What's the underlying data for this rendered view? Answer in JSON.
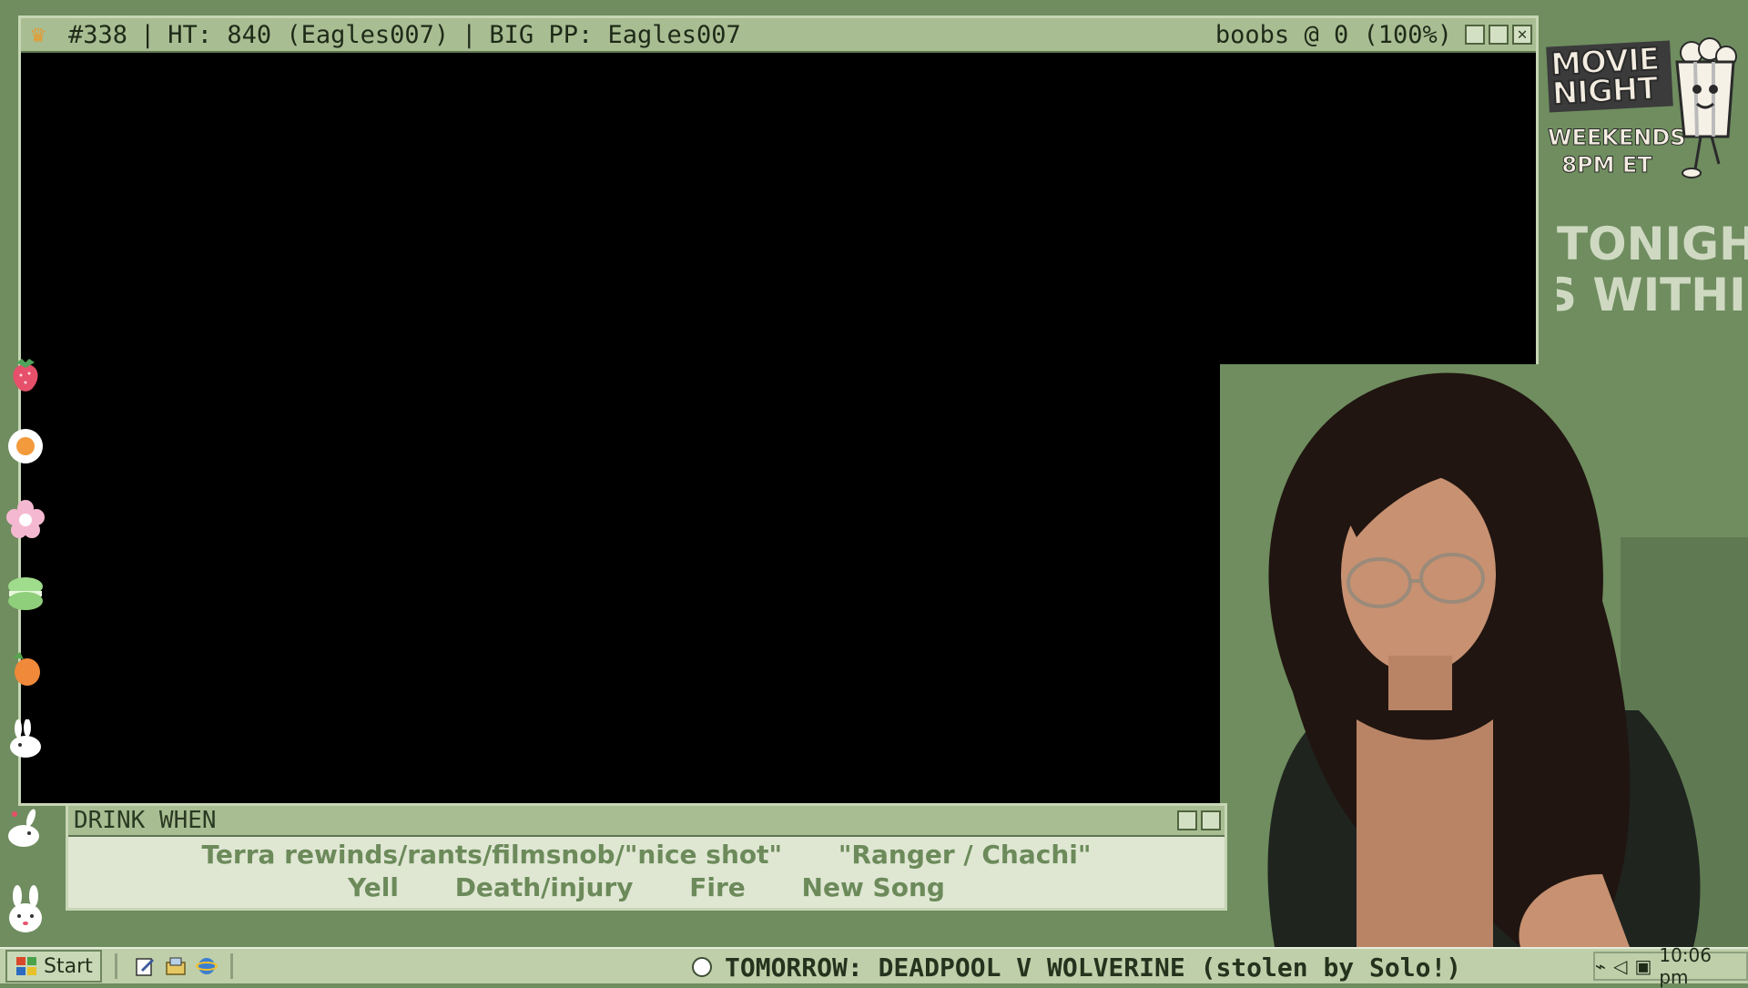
{
  "main_window": {
    "title_id": "#338",
    "title_ht": "HT: 840 (Eagles007)",
    "title_pp": "BIG PP: Eagles007",
    "title_right": "boobs @ 0 (100%)",
    "icon": "crown-icon"
  },
  "promo": {
    "title": "MOVIE NIGHT",
    "days": "WEEKENDS",
    "time": "8PM ET"
  },
  "tonight": {
    "line1": "TONIGHT:",
    "line2": "S WITHI"
  },
  "drink_when": {
    "title": "DRINK WHEN",
    "row1": [
      "Terra rewinds/rants/filmsnob/\"nice shot\"",
      "\"Ranger / Chachi\""
    ],
    "row2": [
      "Yell",
      "Death/injury",
      "Fire",
      "New Song"
    ]
  },
  "taskbar": {
    "start_label": "Start",
    "marquee": "TOMORROW: DEADPOOL V WOLVERINE (stolen by Solo!)",
    "clock": "10:06 pm"
  },
  "decorations": [
    "strawberry-icon",
    "egg-icon",
    "flower-icon",
    "macaron-icon",
    "carrot-icon",
    "bunny-icon",
    "bunny-icon",
    "bunny-icon"
  ],
  "colors": {
    "background": "#6f8d5f",
    "titlebar": "#a8bd92",
    "accent_text": "#6c8a5a"
  }
}
